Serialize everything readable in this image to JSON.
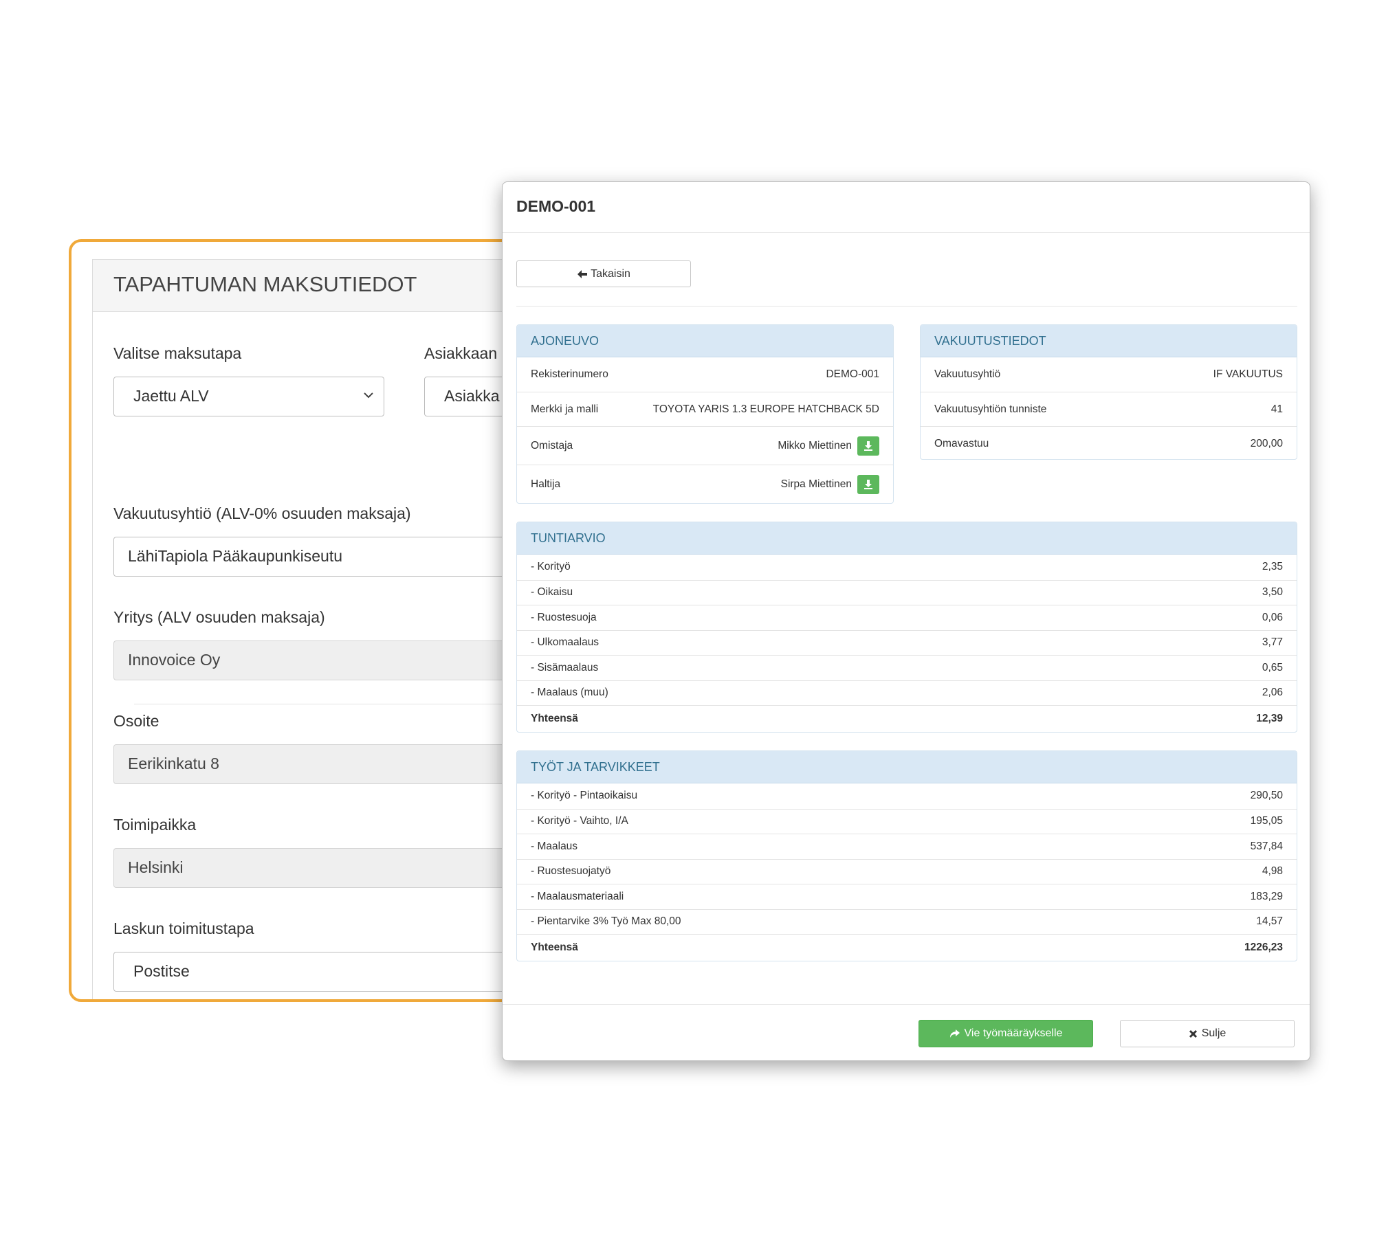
{
  "payment_form": {
    "title": "TAPAHTUMAN MAKSUTIEDOT",
    "payment_method_label": "Valitse maksutapa",
    "payment_method_value": "Jaettu ALV",
    "customer_label": "Asiakkaan",
    "customer_value": "Asiakka",
    "insurer_label": "Vakuutusyhtiö (ALV-0% osuuden maksaja)",
    "insurer_value": "LähiTapiola Pääkaupunkiseutu",
    "company_label": "Yritys (ALV osuuden maksaja)",
    "company_value": "Innovoice Oy",
    "address_label": "Osoite",
    "address_value": "Eerikinkatu 8",
    "city_label": "Toimipaikka",
    "city_value": "Helsinki",
    "delivery_label": "Laskun toimitustapa",
    "delivery_value": "Postitse"
  },
  "modal": {
    "title": "DEMO-001",
    "back_label": "Takaisin",
    "vehicle": {
      "heading": "AJONEUVO",
      "rows": [
        {
          "label": "Rekisterinumero",
          "value": "DEMO-001"
        },
        {
          "label": "Merkki ja malli",
          "value": "TOYOTA YARIS 1.3 EUROPE HATCHBACK 5D"
        },
        {
          "label": "Omistaja",
          "value": "Mikko Miettinen"
        },
        {
          "label": "Haltija",
          "value": "Sirpa Miettinen"
        }
      ]
    },
    "insurance": {
      "heading": "VAKUUTUSTIEDOT",
      "rows": [
        {
          "label": "Vakuutusyhtiö",
          "value": "IF VAKUUTUS"
        },
        {
          "label": "Vakuutusyhtiön tunniste",
          "value": "41"
        },
        {
          "label": "Omavastuu",
          "value": "200,00"
        }
      ]
    },
    "hours": {
      "heading": "TUNTIARVIO",
      "rows": [
        {
          "label": "-  Korityö",
          "value": "2,35"
        },
        {
          "label": "-  Oikaisu",
          "value": "3,50"
        },
        {
          "label": "-  Ruostesuoja",
          "value": "0,06"
        },
        {
          "label": "-  Ulkomaalaus",
          "value": "3,77"
        },
        {
          "label": "-  Sisämaalaus",
          "value": "0,65"
        },
        {
          "label": "-  Maalaus (muu)",
          "value": "2,06"
        }
      ],
      "total_label": "Yhteensä",
      "total_value": "12,39"
    },
    "works": {
      "heading": "TYÖT JA TARVIKKEET",
      "rows": [
        {
          "label": "-  Korityö - Pintaoikaisu",
          "value": "290,50"
        },
        {
          "label": "-  Korityö - Vaihto, I/A",
          "value": "195,05"
        },
        {
          "label": "-  Maalaus",
          "value": "537,84"
        },
        {
          "label": "-  Ruostesuojatyö",
          "value": "4,98"
        },
        {
          "label": "-  Maalausmateriaali",
          "value": "183,29"
        },
        {
          "label": "-  Pientarvike 3% Työ Max 80,00",
          "value": "14,57"
        }
      ],
      "total_label": "Yhteensä",
      "total_value": "1226,23"
    },
    "export_label": "Vie työmääräykselle",
    "close_label": "Sulje"
  },
  "colors": {
    "accent_orange": "#f0a93a",
    "success_green": "#5cb85c",
    "panel_heading_blue": "#d9e8f5"
  }
}
